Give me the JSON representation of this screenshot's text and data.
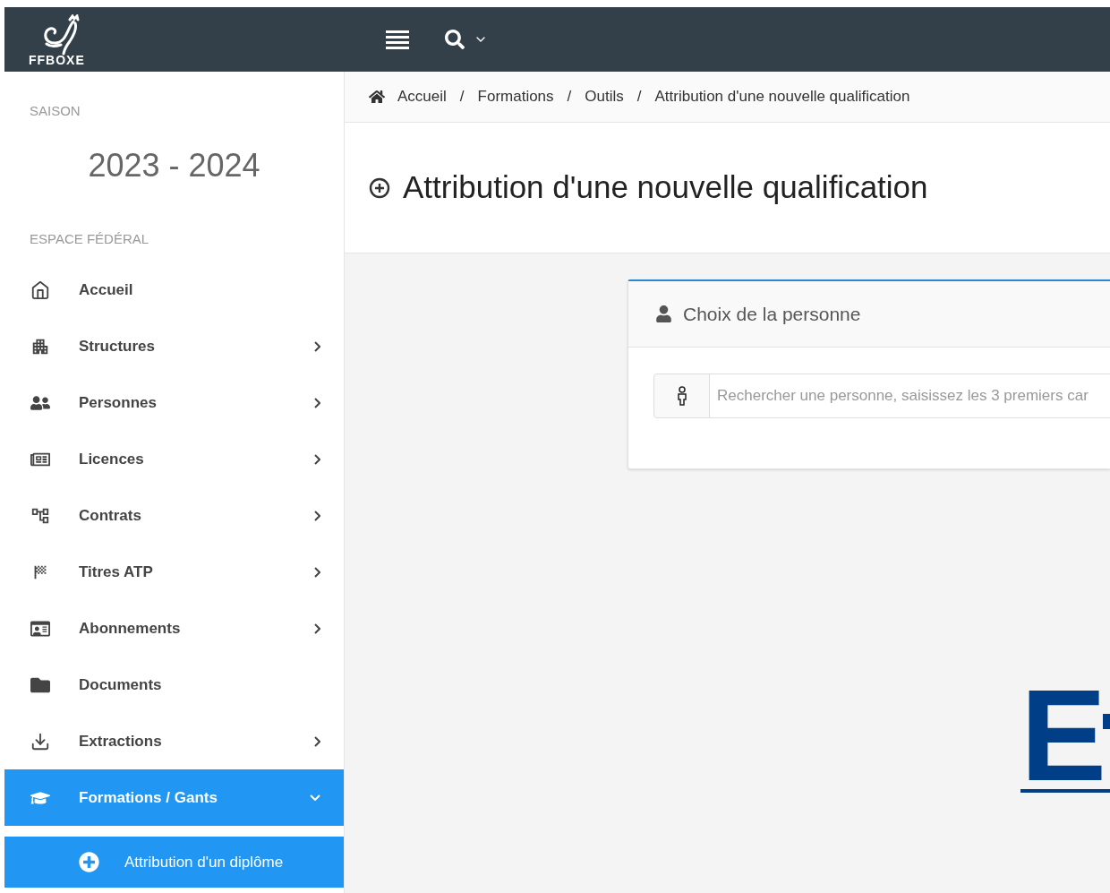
{
  "topbar": {
    "logo_text": "FFBOXE"
  },
  "sidebar": {
    "season_label": "SAISON",
    "season": "2023 - 2024",
    "section_label": "ESPACE FÉDÉRAL",
    "items": [
      {
        "label": "Accueil",
        "has_submenu": false,
        "selected": false
      },
      {
        "label": "Structures",
        "has_submenu": true,
        "expanded": false,
        "selected": false
      },
      {
        "label": "Personnes",
        "has_submenu": true,
        "expanded": false,
        "selected": false
      },
      {
        "label": "Licences",
        "has_submenu": true,
        "expanded": false,
        "selected": false
      },
      {
        "label": "Contrats",
        "has_submenu": true,
        "expanded": false,
        "selected": false
      },
      {
        "label": "Titres ATP",
        "has_submenu": true,
        "expanded": false,
        "selected": false
      },
      {
        "label": "Abonnements",
        "has_submenu": true,
        "expanded": false,
        "selected": false
      },
      {
        "label": "Documents",
        "has_submenu": false,
        "selected": false
      },
      {
        "label": "Extractions",
        "has_submenu": true,
        "expanded": false,
        "selected": false
      },
      {
        "label": "Formations / Gants",
        "has_submenu": true,
        "expanded": true,
        "selected": true,
        "children": [
          {
            "label": "Attribution d'un diplôme",
            "selected": true
          }
        ]
      }
    ]
  },
  "breadcrumb": [
    {
      "label": "Accueil"
    },
    {
      "separator": "/",
      "label": "Formations"
    },
    {
      "separator": "/",
      "label": "Outils"
    },
    {
      "separator": "/",
      "label": "Attribution d'une nouvelle qualification"
    }
  ],
  "page_title": "Attribution d'une nouvelle qualification",
  "card": {
    "title": "Choix de la personne",
    "search": {
      "placeholder": "Rechercher une personne, saisissez les 3 premiers car"
    }
  },
  "logo": {
    "letter": "E"
  }
}
